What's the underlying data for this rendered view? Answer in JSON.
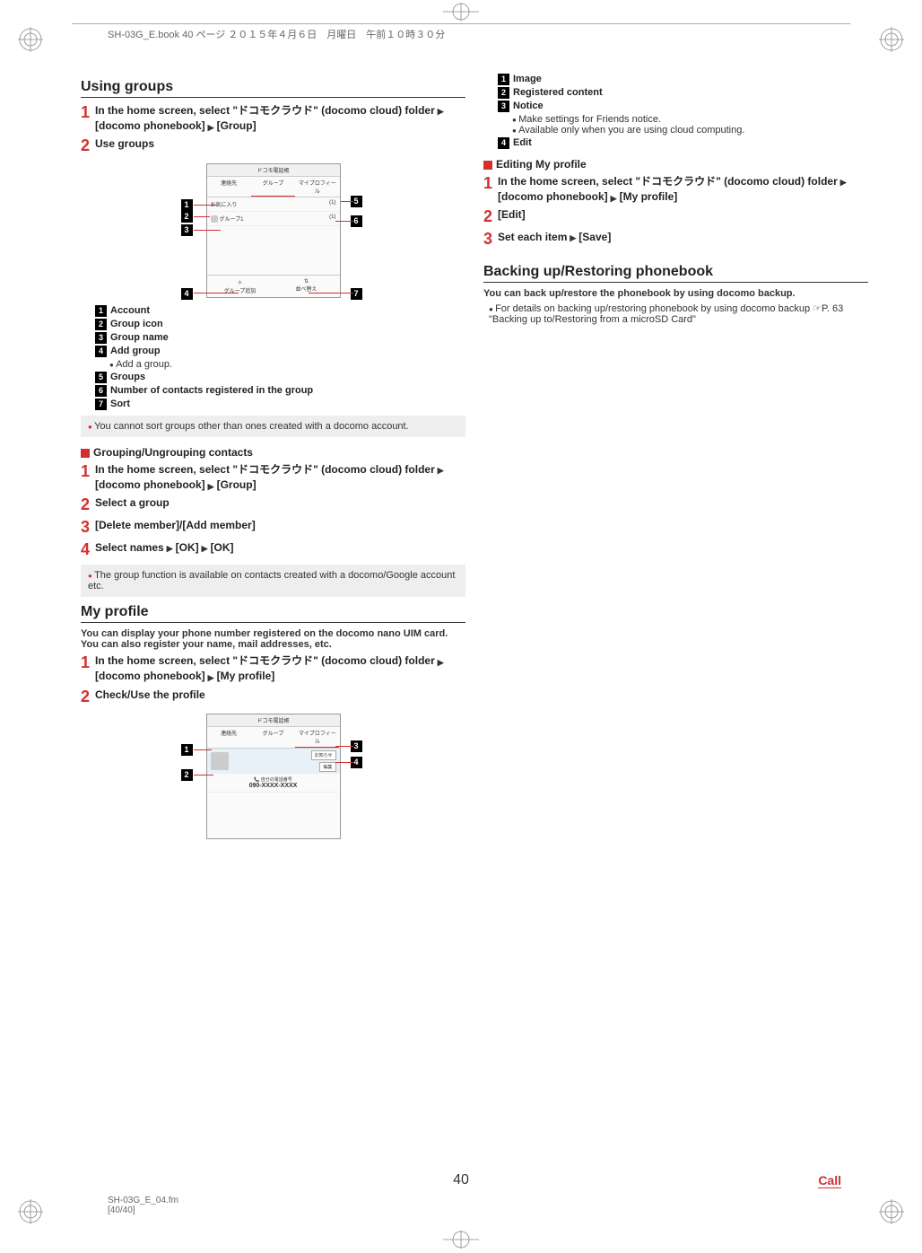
{
  "header": "SH-03G_E.book  40 ページ  ２０１５年４月６日　月曜日　午前１０時３０分",
  "pageNumber": "40",
  "footerLink": "Call",
  "footerFile1": "SH-03G_E_04.fm",
  "footerFile2": "[40/40]",
  "left": {
    "title1": "Using groups",
    "step1_1": "In the home screen, select \"ドコモクラウド\" (docomo cloud) folder",
    "step1_2": "[docomo phonebook]",
    "step1_3": "[Group]",
    "step2": "Use groups",
    "fig1": {
      "header": "ドコモ電話帳",
      "tab1": "連絡先",
      "tab2": "グループ",
      "tab3": "マイプロフィール",
      "row1a": "お気に入り",
      "row1b": "(1)",
      "row2a": "グループ1",
      "row2b": "(1)",
      "bottom1": "グループ追加",
      "bottom2": "並べ替え"
    },
    "legend1": {
      "n": "1",
      "t": "Account"
    },
    "legend2": {
      "n": "2",
      "t": "Group icon"
    },
    "legend3": {
      "n": "3",
      "t": "Group name"
    },
    "legend4": {
      "n": "4",
      "t": "Add group"
    },
    "legend4sub": "Add a group.",
    "legend5": {
      "n": "5",
      "t": "Groups"
    },
    "legend6": {
      "n": "6",
      "t": "Number of contacts registered in the group"
    },
    "legend7": {
      "n": "7",
      "t": "Sort"
    },
    "note1": "You cannot sort groups other than ones created with a docomo account.",
    "sub1": "Grouping/Ungrouping contacts",
    "g_step1_1": "In the home screen, select \"ドコモクラウド\" (docomo cloud) folder",
    "g_step1_2": "[docomo phonebook]",
    "g_step1_3": "[Group]",
    "g_step2": "Select a group",
    "g_step3": "[Delete member]/[Add member]",
    "g_step4_1": "Select names",
    "g_step4_2": "[OK]",
    "g_step4_3": "[OK]",
    "note2": "The group function is available on contacts created with a docomo/Google account etc.",
    "title2": "My profile",
    "myprofile_desc": "You can display your phone number registered on the docomo nano UIM card. You can also register your name, mail addresses, etc.",
    "mp_step1_1": "In the home screen, select \"ドコモクラウド\" (docomo cloud) folder",
    "mp_step1_2": "[docomo phonebook]",
    "mp_step1_3": "[My profile]",
    "mp_step2": "Check/Use the profile",
    "fig2": {
      "header": "ドコモ電話帳",
      "tab1": "連絡先",
      "tab2": "グループ",
      "tab3": "マイプロフィール",
      "notice": "お知らせ",
      "edit": "編集",
      "phone_label": "自分の電話番号",
      "phone": "090-XXXX-XXXX"
    }
  },
  "right": {
    "rlegend1": {
      "n": "1",
      "t": "Image"
    },
    "rlegend2": {
      "n": "2",
      "t": "Registered content"
    },
    "rlegend3": {
      "n": "3",
      "t": "Notice"
    },
    "rlegend3sub1": "Make settings for Friends notice.",
    "rlegend3sub2": "Available only when you are using cloud computing.",
    "rlegend4": {
      "n": "4",
      "t": "Edit"
    },
    "sub2": "Editing My profile",
    "e_step1_1": "In the home screen, select \"ドコモクラウド\" (docomo cloud) folder",
    "e_step1_2": "[docomo phonebook]",
    "e_step1_3": "[My profile]",
    "e_step2": "[Edit]",
    "e_step3_1": "Set each item",
    "e_step3_2": "[Save]",
    "title3": "Backing up/Restoring phonebook",
    "backup_desc": "You can back up/restore the phonebook by using docomo backup.",
    "backup_bullet": "For details on backing up/restoring phonebook by using docomo backup ☞P. 63 \"Backing up to/Restoring from a microSD Card\""
  }
}
